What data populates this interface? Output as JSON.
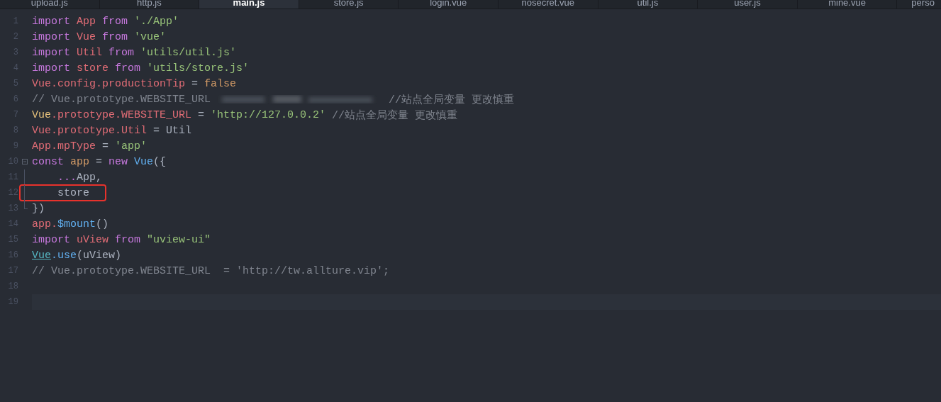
{
  "tabs": [
    {
      "label": "upload.js",
      "selected": false
    },
    {
      "label": "http.js",
      "selected": false
    },
    {
      "label": "main.js",
      "selected": true
    },
    {
      "label": "store.js",
      "selected": false
    },
    {
      "label": "login.vue",
      "selected": false
    },
    {
      "label": "nosecret.vue",
      "selected": false
    },
    {
      "label": "util.js",
      "selected": false
    },
    {
      "label": "user.js",
      "selected": false
    },
    {
      "label": "mine.vue",
      "selected": false
    },
    {
      "label": "perso",
      "selected": false
    }
  ],
  "editor": {
    "lines": [
      {
        "number": "1",
        "tokens": [
          {
            "kind": "keyword",
            "text": "import "
          },
          {
            "kind": "variable",
            "text": "App "
          },
          {
            "kind": "keyword",
            "text": "from "
          },
          {
            "kind": "string",
            "text": "'./App'"
          }
        ]
      },
      {
        "number": "2",
        "tokens": [
          {
            "kind": "keyword",
            "text": "import "
          },
          {
            "kind": "variable",
            "text": "Vue "
          },
          {
            "kind": "keyword",
            "text": "from "
          },
          {
            "kind": "string",
            "text": "'vue'"
          }
        ]
      },
      {
        "number": "3",
        "tokens": [
          {
            "kind": "keyword",
            "text": "import "
          },
          {
            "kind": "variable",
            "text": "Util "
          },
          {
            "kind": "keyword",
            "text": "from "
          },
          {
            "kind": "string",
            "text": "'utils/util.js'"
          }
        ]
      },
      {
        "number": "4",
        "tokens": [
          {
            "kind": "keyword",
            "text": "import "
          },
          {
            "kind": "variable",
            "text": "store "
          },
          {
            "kind": "keyword",
            "text": "from "
          },
          {
            "kind": "string",
            "text": "'utils/store.js'"
          }
        ]
      },
      {
        "number": "5",
        "tokens": [
          {
            "kind": "variable",
            "text": "Vue.config.productionTip "
          },
          {
            "kind": "plain",
            "text": "= "
          },
          {
            "kind": "number",
            "text": "false"
          }
        ]
      },
      {
        "number": "6",
        "tokens": [
          {
            "kind": "comment",
            "text": "// Vue.prototype.WEBSITE_URL"
          },
          {
            "kind": "blur"
          },
          {
            "kind": "comment",
            "text": "//站点全局变量 更改慎重"
          }
        ]
      },
      {
        "number": "7",
        "tokens": [
          {
            "kind": "class",
            "text": "Vue"
          },
          {
            "kind": "variable",
            "text": ".prototype.WEBSITE_URL "
          },
          {
            "kind": "plain",
            "text": "= "
          },
          {
            "kind": "string",
            "text": "'http://127.0.0.2' "
          },
          {
            "kind": "comment",
            "text": "//站点全局变量 更改慎重"
          }
        ]
      },
      {
        "number": "8",
        "tokens": [
          {
            "kind": "variable",
            "text": "Vue.prototype.Util "
          },
          {
            "kind": "plain",
            "text": "= Util"
          }
        ]
      },
      {
        "number": "9",
        "tokens": [
          {
            "kind": "variable",
            "text": "App.mpType "
          },
          {
            "kind": "plain",
            "text": "= "
          },
          {
            "kind": "string",
            "text": "'app'"
          }
        ]
      },
      {
        "number": "10",
        "expanded": true,
        "tokens": [
          {
            "kind": "keyword",
            "text": "const "
          },
          {
            "kind": "number",
            "text": "app "
          },
          {
            "kind": "plain",
            "text": "= "
          },
          {
            "kind": "keyword",
            "text": "new "
          },
          {
            "kind": "function",
            "text": "Vue"
          },
          {
            "kind": "plain",
            "text": "({"
          }
        ],
        "children": [
          {
            "number": "11",
            "tokens": [
              {
                "kind": "keyword",
                "text": "    ..."
              },
              {
                "kind": "plain",
                "text": "App,"
              }
            ]
          },
          {
            "number": "12",
            "highlighted": true,
            "tokens": [
              {
                "kind": "plain",
                "text": "    store"
              }
            ]
          },
          {
            "number": "13",
            "tokens": [
              {
                "kind": "plain",
                "text": "})"
              }
            ]
          }
        ]
      },
      {
        "number": "14",
        "tokens": [
          {
            "kind": "variable",
            "text": "app."
          },
          {
            "kind": "function",
            "text": "$mount"
          },
          {
            "kind": "plain",
            "text": "()"
          }
        ]
      },
      {
        "number": "15",
        "tokens": [
          {
            "kind": "keyword",
            "text": "import "
          },
          {
            "kind": "variable",
            "text": "uView "
          },
          {
            "kind": "keyword",
            "text": "from "
          },
          {
            "kind": "string",
            "text": "\"uview-ui\""
          }
        ]
      },
      {
        "number": "16",
        "tokens": [
          {
            "kind": "link",
            "text": "Vue"
          },
          {
            "kind": "function",
            "text": ".use"
          },
          {
            "kind": "plain",
            "text": "(uView)"
          }
        ]
      },
      {
        "number": "17",
        "tokens": [
          {
            "kind": "comment",
            "text": "// Vue.prototype.WEBSITE_URL  = 'http://tw.allture.vip';"
          }
        ]
      },
      {
        "number": "18"
      },
      {
        "number": "19",
        "current": true
      }
    ]
  }
}
